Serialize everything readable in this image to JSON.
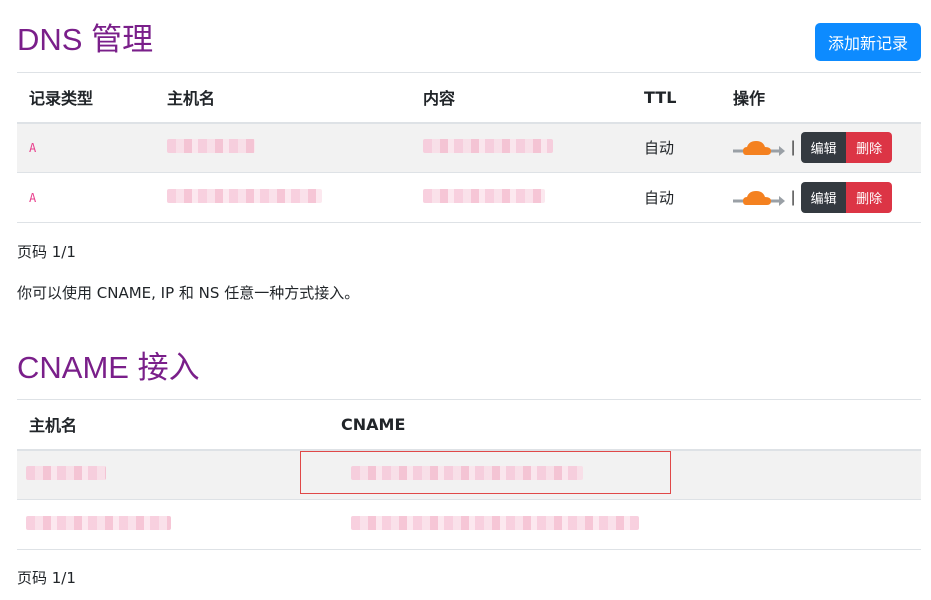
{
  "dns": {
    "title": "DNS 管理",
    "add_button": "添加新记录",
    "columns": [
      "记录类型",
      "主机名",
      "内容",
      "TTL",
      "操作"
    ],
    "rows": [
      {
        "type": "A",
        "ttl": "自动",
        "edit": "编辑",
        "delete": "删除",
        "proxy_icon": "cloudflare-proxy-icon"
      },
      {
        "type": "A",
        "ttl": "自动",
        "edit": "编辑",
        "delete": "删除",
        "proxy_icon": "cloudflare-proxy-icon"
      }
    ],
    "pager": "页码 1/1",
    "hint": "你可以使用 CNAME, IP 和 NS 任意一种方式接入。"
  },
  "cname": {
    "title": "CNAME 接入",
    "columns": [
      "主机名",
      "CNAME"
    ],
    "pager": "页码 1/1"
  },
  "colors": {
    "title": "#7a1f8a",
    "primary": "#0d8bff",
    "danger": "#dc3545",
    "dark": "#343a40",
    "cloud": "#f48120"
  }
}
